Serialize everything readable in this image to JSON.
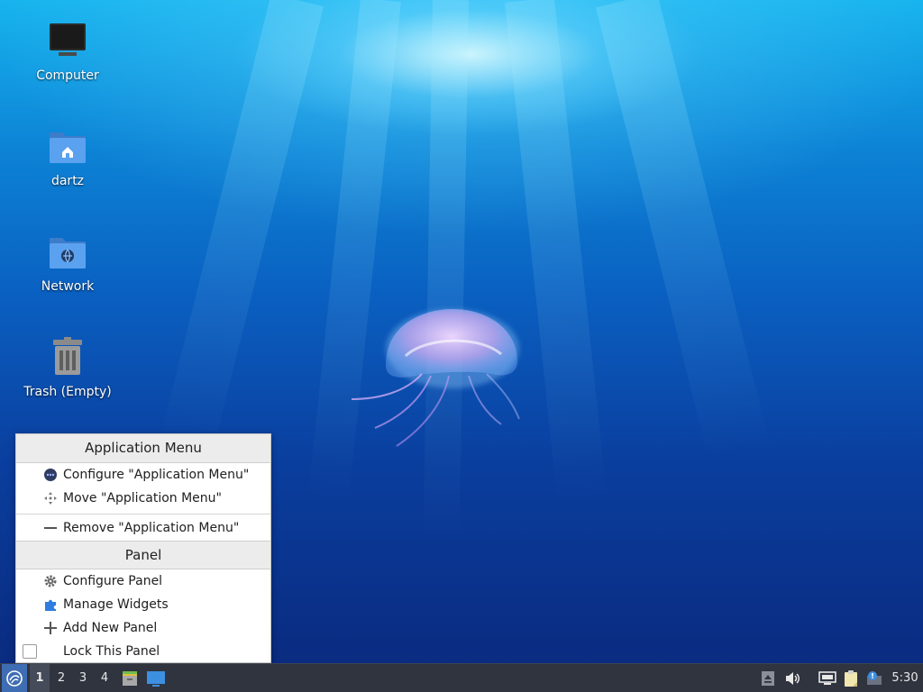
{
  "desktop": {
    "icons": [
      {
        "label": "Computer",
        "icon": "computer-icon"
      },
      {
        "label": "dartz",
        "icon": "home-folder-icon"
      },
      {
        "label": "Network",
        "icon": "network-folder-icon"
      },
      {
        "label": "Trash (Empty)",
        "icon": "trash-icon"
      }
    ]
  },
  "context_menu": {
    "section1_title": "Application Menu",
    "section1_items": [
      {
        "label": "Configure \"Application Menu\"",
        "icon": "configure-icon"
      },
      {
        "label": "Move \"Application Menu\"",
        "icon": "move-icon"
      },
      {
        "label": "Remove \"Application Menu\"",
        "icon": "remove-icon"
      }
    ],
    "section2_title": "Panel",
    "section2_items": [
      {
        "label": "Configure Panel",
        "icon": "gear-icon"
      },
      {
        "label": "Manage Widgets",
        "icon": "puzzle-icon"
      },
      {
        "label": "Add New Panel",
        "icon": "plus-icon"
      },
      {
        "label": "Lock This Panel",
        "icon": "checkbox",
        "checked": false
      }
    ]
  },
  "taskbar": {
    "workspaces": [
      "1",
      "2",
      "3",
      "4"
    ],
    "active_workspace": "1",
    "clock": "5:30"
  },
  "colors": {
    "taskbar_bg": "#2f343f",
    "menu_header_bg": "#ececec",
    "accent": "#3d8fe0"
  }
}
